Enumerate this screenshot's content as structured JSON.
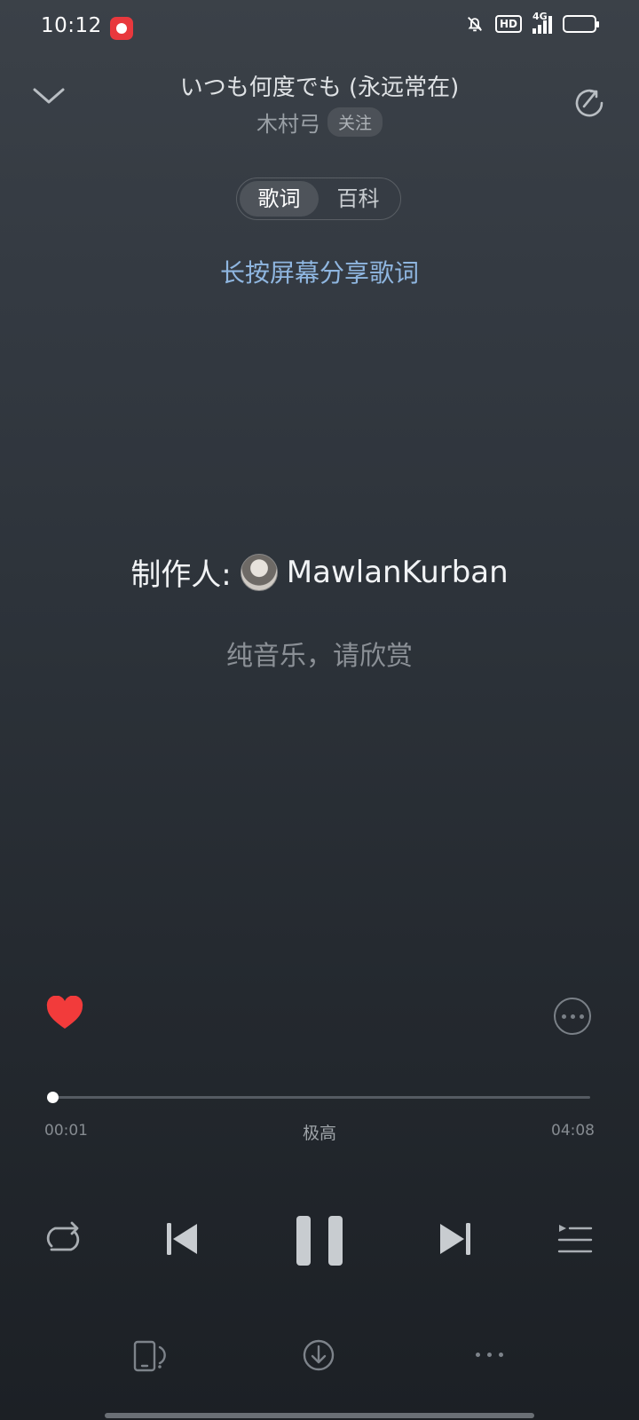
{
  "status_bar": {
    "time": "10:12",
    "hd": "HD",
    "network": "4G",
    "battery_level": 1.0
  },
  "header": {
    "title": "いつも何度でも (永远常在)",
    "artist": "木村弓",
    "follow_label": "关注"
  },
  "tabs": [
    {
      "label": "歌词",
      "active": true
    },
    {
      "label": "百科",
      "active": false
    }
  ],
  "share_hint": "长按屏幕分享歌词",
  "lyrics": {
    "producer_label": "制作人:",
    "producer_name": "MawlanKurban",
    "note": "纯音乐，请欣赏"
  },
  "player": {
    "liked": true,
    "current_time": "00:01",
    "total_time": "04:08",
    "progress": 0.004,
    "quality": "极高"
  },
  "colors": {
    "accent_like": "#f23b3b",
    "hint_text": "#8fb6e0"
  },
  "icons": {
    "collapse": "chevron-down-icon",
    "share": "share-icon",
    "like": "heart-icon",
    "more": "more-icon",
    "repeat": "repeat-icon",
    "previous": "previous-icon",
    "pause": "pause-icon",
    "next": "next-icon",
    "queue": "playlist-icon",
    "device": "device-icon",
    "download": "download-icon"
  }
}
